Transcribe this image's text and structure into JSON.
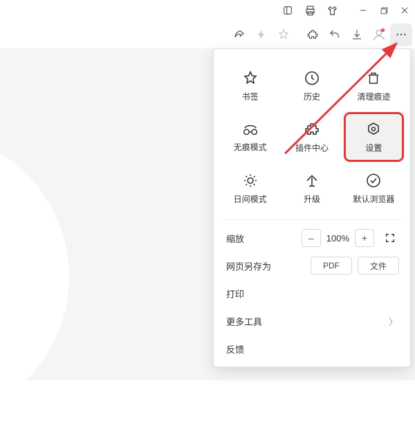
{
  "menu": {
    "grid": [
      {
        "label": "书签"
      },
      {
        "label": "历史"
      },
      {
        "label": "清理痕迹"
      },
      {
        "label": "无痕模式"
      },
      {
        "label": "插件中心"
      },
      {
        "label": "设置"
      },
      {
        "label": "日间模式"
      },
      {
        "label": "升级"
      },
      {
        "label": "默认浏览器"
      }
    ],
    "zoom": {
      "label": "缩放",
      "minus": "–",
      "value": "100%",
      "plus": "+"
    },
    "saveAs": {
      "label": "网页另存为",
      "pdf": "PDF",
      "file": "文件"
    },
    "print": "打印",
    "moreTools": "更多工具",
    "feedback": "反馈"
  }
}
